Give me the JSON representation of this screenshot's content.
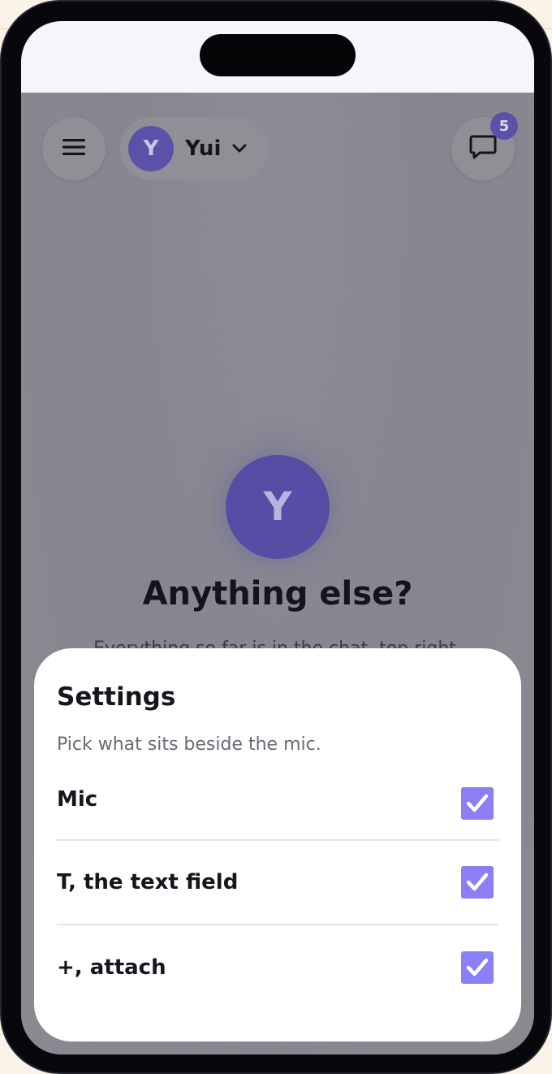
{
  "header": {
    "persona": {
      "initial": "Y",
      "name": "Yui"
    },
    "chat_badge": "5"
  },
  "main": {
    "avatar_initial": "Y",
    "title": "Anything else?",
    "subtitle": "Everything so far is in the chat, top right."
  },
  "settings": {
    "title": "Settings",
    "subtitle": "Pick what sits beside the mic.",
    "options": [
      {
        "label": "Mic",
        "checked": true
      },
      {
        "label": "T, the text field",
        "checked": true
      },
      {
        "label": "+, attach",
        "checked": true
      }
    ]
  },
  "colors": {
    "accent": "#8b7ff5",
    "avatar": "#554ea4",
    "dim_overlay": "#8b8a92"
  }
}
